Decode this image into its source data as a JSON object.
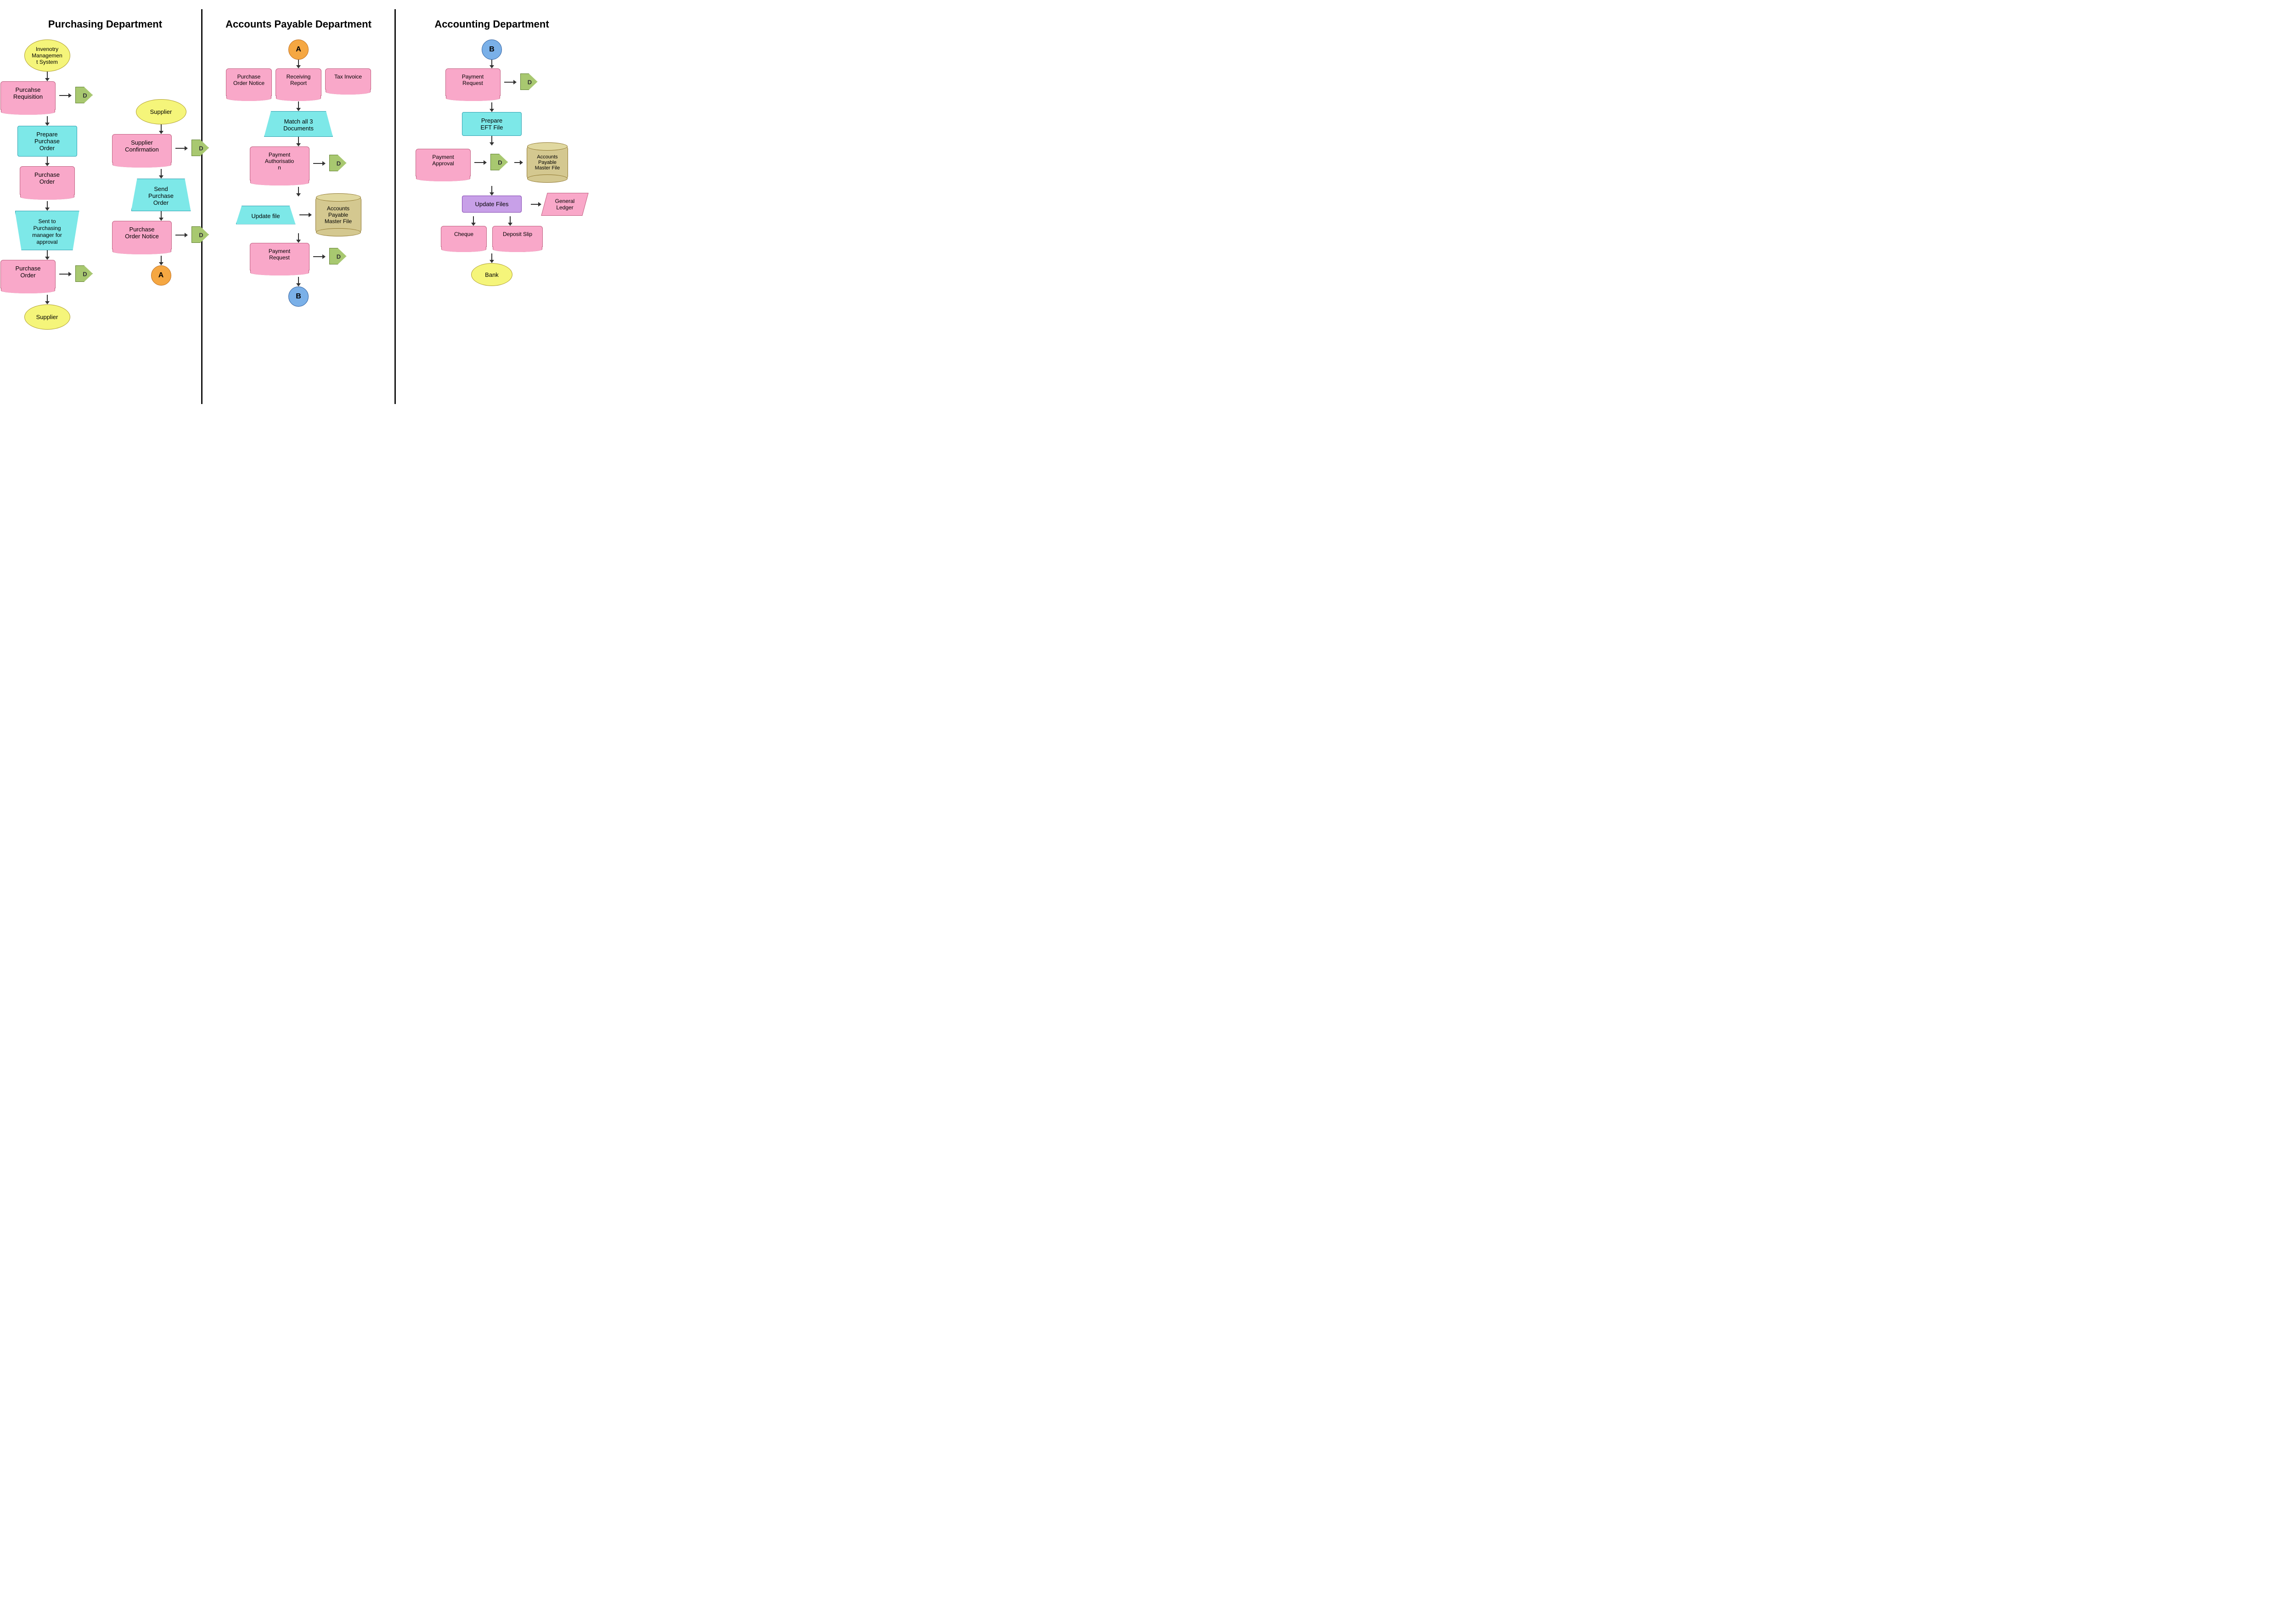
{
  "departments": {
    "purchasing": {
      "title": "Purchasing Department",
      "col1": {
        "ims": "Invenotry\nManagement\nSystem",
        "requisition": "Purcahse\nRequisition",
        "prepare_po": "Prepare\nPurchase\nOrder",
        "purchase_order": "Purchase\nOrder",
        "sent_to": "Sent to\nPurchasing\nmanager for\napproval",
        "purchase_order2": "Purchase\nOrder",
        "supplier": "Supplier",
        "d_label": "D"
      },
      "col2": {
        "supplier": "Supplier",
        "supplier_confirm": "Supplier\nConfirmation",
        "send_po": "Send\nPurchase\nOrder",
        "po_notice": "Purchase\nOrder Notice",
        "circle_a": "A",
        "d_label": "D",
        "d_label2": "D",
        "d_label3": "D"
      }
    },
    "ap": {
      "title": "Accounts Payable Department",
      "circle_a": "A",
      "po_notice": "Purchase\nOrder Notice",
      "receiving_report": "Receiving\nReport",
      "tax_invoice": "Tax Invoice",
      "match": "Match all 3\nDocuments",
      "payment_auth": "Payment\nAuthorisatio\nn",
      "update_file": "Update file",
      "ap_master": "Accounts\nPayable\nMaster File",
      "payment_request": "Payment\nRequest",
      "circle_b": "B",
      "d_label": "D"
    },
    "accounting": {
      "title": "Accounting Department",
      "circle_b": "B",
      "payment_request": "Payment\nRequest",
      "prepare_eft": "Prepare\nEFT File",
      "payment_approval": "Payment\nApproval",
      "update_files": "Update Files",
      "ap_master": "Accounts\nPayable\nMaster File",
      "general_ledger": "General\nLedger",
      "cheque": "Cheque",
      "deposit_slip": "Deposit Slip",
      "bank": "Bank",
      "d_label": "D",
      "d_label2": "D"
    }
  }
}
